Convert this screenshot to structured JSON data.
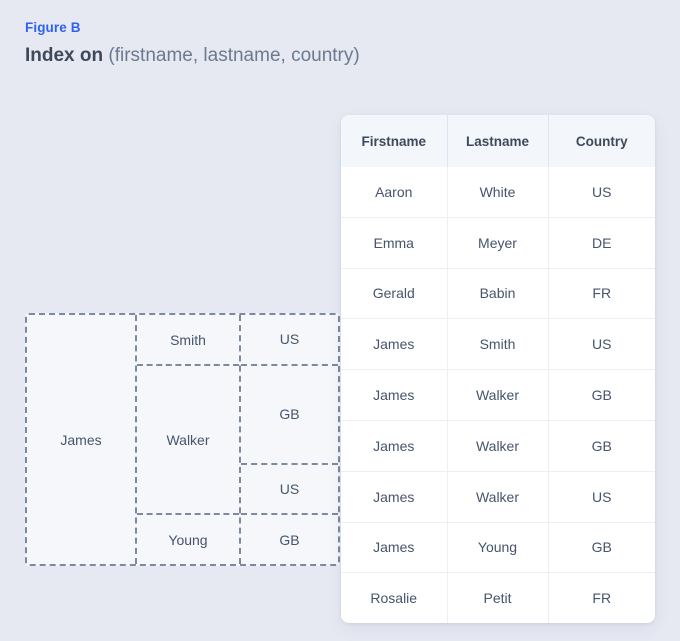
{
  "heading": {
    "figure_label": "Figure B",
    "title_strong": "Index on",
    "title_rest": "(firstname, lastname, country)"
  },
  "index_diagram": {
    "name": "composite-index-tree",
    "firstname_cells": [
      {
        "label": "James",
        "row_span": 5
      }
    ],
    "lastname_cells": [
      {
        "label": "Smith",
        "row_span": 1
      },
      {
        "label": "Walker",
        "row_span": 3
      },
      {
        "label": "Young",
        "row_span": 1
      }
    ],
    "country_cells": [
      {
        "label": "US",
        "row_span": 1
      },
      {
        "label": "GB",
        "row_span": 2
      },
      {
        "label": "US",
        "row_span": 1
      },
      {
        "label": "GB",
        "row_span": 1
      }
    ]
  },
  "table": {
    "columns": [
      "Firstname",
      "Lastname",
      "Country"
    ],
    "rows": [
      [
        "Aaron",
        "White",
        "US"
      ],
      [
        "Emma",
        "Meyer",
        "DE"
      ],
      [
        "Gerald",
        "Babin",
        "FR"
      ],
      [
        "James",
        "Smith",
        "US"
      ],
      [
        "James",
        "Walker",
        "GB"
      ],
      [
        "James",
        "Walker",
        "GB"
      ],
      [
        "James",
        "Walker",
        "US"
      ],
      [
        "James",
        "Young",
        "GB"
      ],
      [
        "Rosalie",
        "Petit",
        "FR"
      ]
    ]
  },
  "colors": {
    "page_background": "#e6e9f2",
    "figure_label": "#2f62f0",
    "title_strong": "#3d4a5c",
    "title_rest": "#6b7a90",
    "table_header_background": "#f3f6fa",
    "table_header_divider": "#dbe7f4",
    "table_row_divider": "#eceff4",
    "table_background": "#ffffff",
    "diagram_fill": "#f5f7fa",
    "diagram_dash": "#7c8aa0",
    "text": "#46556b"
  }
}
